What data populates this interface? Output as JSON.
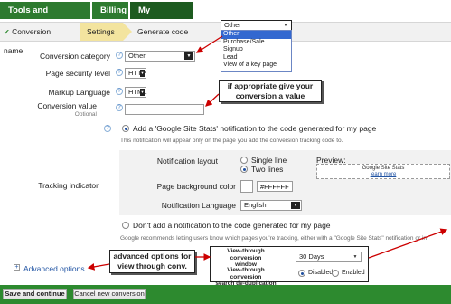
{
  "nav": {
    "tools_label": "Tools and Analysis",
    "billing_label": "Billing",
    "account_label": "My account"
  },
  "steps": {
    "conversion_name": "Conversion name",
    "settings": "Settings",
    "generate_code": "Generate code",
    "check": "✔"
  },
  "form": {
    "conversion_category": {
      "label": "Conversion category",
      "value": "Other"
    },
    "page_security": {
      "label": "Page security level",
      "value": "HTTP"
    },
    "markup_language": {
      "label": "Markup Language",
      "value": "HTML"
    },
    "conversion_value": {
      "label": "Conversion value",
      "sublabel": "Optional",
      "value": ""
    },
    "add_notification_label": "Add a 'Google Site Stats' notification to the code generated for my page",
    "add_notification_note": "This notification will appear only on the page you add the conversion tracking code to.",
    "tracking_indicator_label": "Tracking indicator",
    "notification_layout": {
      "label": "Notification layout",
      "options": [
        "Single line",
        "Two lines"
      ]
    },
    "page_bg_color": {
      "label": "Page background color",
      "value": "#FFFFFF"
    },
    "notification_language": {
      "label": "Notification Language",
      "value": "English"
    },
    "preview": {
      "label": "Preview:",
      "line1": "Google Site Stats",
      "line2": "learn more"
    },
    "dont_add_label": "Don't add a notification to the code generated for my page",
    "dont_add_note": "Google recommends letting users know which pages you're tracking, either with a \"Google Site Stats\" notification or in",
    "advanced_options": "Advanced options",
    "view_through_window": {
      "label_line1": "View-through conversion",
      "label_line2": "window",
      "value": "30 Days"
    },
    "view_through_dedup": {
      "label_line1": "View-through conversion",
      "label_line2": "search de-duplication",
      "options": [
        "Disabled",
        "Enabled"
      ]
    }
  },
  "dropdown": {
    "selected": "Other",
    "options": [
      "Other",
      "Purchase/Sale",
      "Signup",
      "Lead",
      "View of a key page"
    ]
  },
  "callouts": {
    "value_line1": "if appropriate give your",
    "value_line2": "conversion a value",
    "advanced_line1": "advanced options for",
    "advanced_line2": "view through conv."
  },
  "buttons": {
    "save": "Save and continue",
    "cancel": "Cancel new conversion"
  },
  "colors": {
    "nav_green": "#2d7a2f",
    "nav_dark_green": "#1d5b20",
    "step_active": "#f3e49f",
    "link_blue": "#2255a4",
    "bottom_bar": "#2d8a2f"
  },
  "icons": {
    "help": "question-mark-circle",
    "check": "checkmark",
    "expand": "plus-box"
  }
}
